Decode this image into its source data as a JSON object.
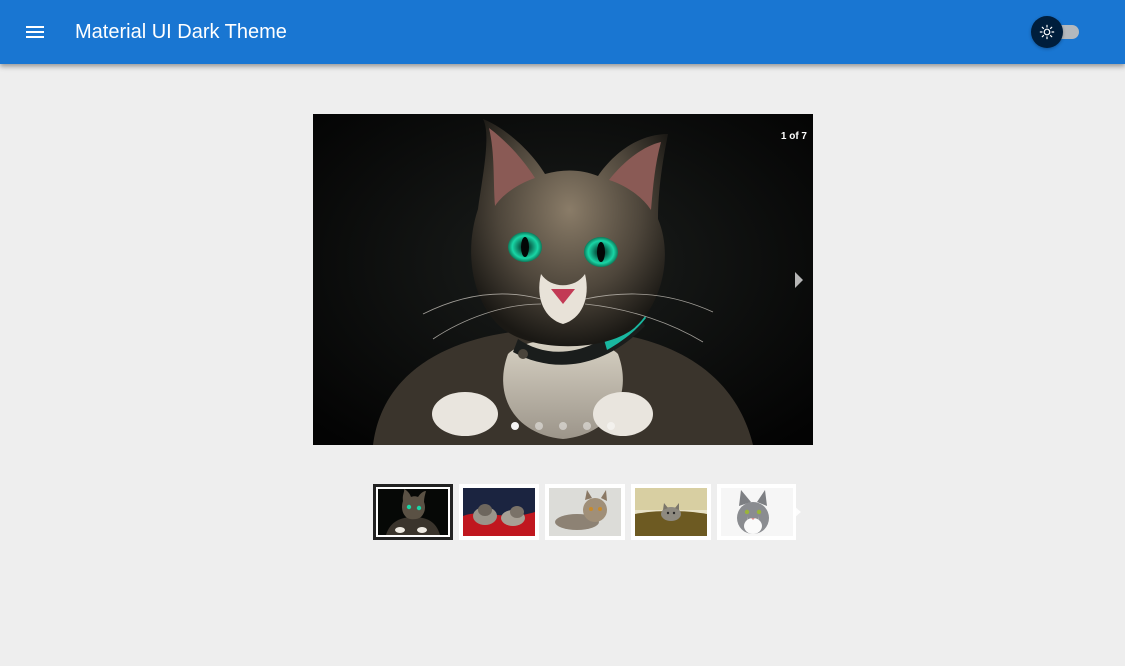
{
  "appbar": {
    "title": "Material UI Dark Theme",
    "menu_icon": "menu-icon",
    "theme_toggle_icon": "sun-icon",
    "color": "#1976d2"
  },
  "gallery": {
    "counter": "1 of 7",
    "current_index": 1,
    "total_slides": 7,
    "visible_dots": 5,
    "next_icon": "chevron-right-icon"
  },
  "thumbnails": {
    "items": [
      {
        "subject": "tabby cat with green eyes on dark background",
        "selected": true
      },
      {
        "subject": "two kittens on red blanket",
        "selected": false
      },
      {
        "subject": "tabby cat lying on white",
        "selected": false
      },
      {
        "subject": "kitten peeking over olive cushion",
        "selected": false
      },
      {
        "subject": "grey and white cat on white",
        "selected": false
      }
    ]
  }
}
